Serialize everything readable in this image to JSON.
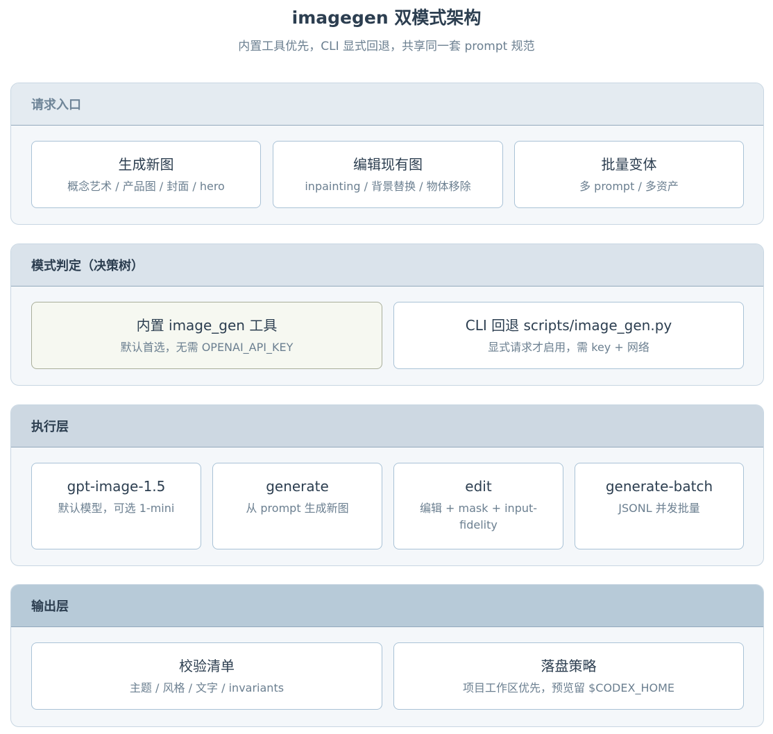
{
  "header": {
    "title": "imagegen 双模式架构",
    "subtitle": "内置工具优先，CLI 显式回退，共享同一套 prompt 规范"
  },
  "layers": [
    {
      "label": "请求入口",
      "header_bg": "#e4ebf1",
      "label_color": "#6f8598",
      "cards": [
        {
          "title": "生成新图",
          "desc": "概念艺术 / 产品图 / 封面 / hero"
        },
        {
          "title": "编辑现有图",
          "desc": "inpainting / 背景替换 / 物体移除"
        },
        {
          "title": "批量变体",
          "desc": "多 prompt / 多资产"
        }
      ]
    },
    {
      "label": "模式判定（决策树）",
      "header_bg": "#dae3eb",
      "label_color": "#2c3e50",
      "cards": [
        {
          "title": "内置 image_gen 工具",
          "desc": "默认首选，无需 OPENAI_API_KEY",
          "highlight": true
        },
        {
          "title": "CLI 回退 scripts/image_gen.py",
          "desc": "显式请求才启用，需 key + 网络"
        }
      ]
    },
    {
      "label": "执行层",
      "header_bg": "#cdd8e2",
      "label_color": "#2c3e50",
      "cards": [
        {
          "title": "gpt-image-1.5",
          "desc": "默认模型，可选 1-mini"
        },
        {
          "title": "generate",
          "desc": "从 prompt 生成新图"
        },
        {
          "title": "edit",
          "desc": "编辑 + mask + input-fidelity"
        },
        {
          "title": "generate-batch",
          "desc": "JSONL 并发批量"
        }
      ]
    },
    {
      "label": "输出层",
      "header_bg": "#b7cad8",
      "label_color": "#2c3e50",
      "cards": [
        {
          "title": "校验清单",
          "desc": "主题 / 风格 / 文字 / invariants"
        },
        {
          "title": "落盘策略",
          "desc": "项目工作区优先，预览留 $CODEX_HOME"
        }
      ]
    }
  ]
}
